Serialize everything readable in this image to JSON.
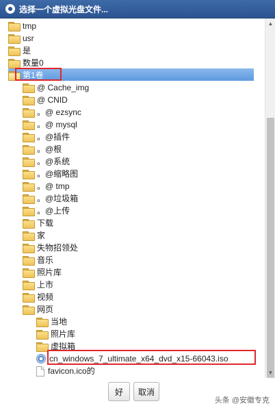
{
  "dialog": {
    "title": "选择一个虚拟光盘文件..."
  },
  "tree": {
    "items": [
      {
        "label": "tmp",
        "icon": "folder-icon",
        "level": 0
      },
      {
        "label": "usr",
        "icon": "folder-icon",
        "level": 0
      },
      {
        "label": "是",
        "icon": "folder-icon",
        "level": 0
      },
      {
        "label": "数量0",
        "icon": "folder-icon",
        "level": 0
      },
      {
        "label": "第1卷",
        "icon": "folder-open-icon",
        "level": 0,
        "selected": true,
        "expanded": true
      },
      {
        "label": "@ Cache_img",
        "icon": "folder-icon",
        "level": 1
      },
      {
        "label": "@ CNID",
        "icon": "folder-icon",
        "level": 1
      },
      {
        "label": "。@ ezsync",
        "icon": "folder-icon",
        "level": 1
      },
      {
        "label": "。@ mysql",
        "icon": "folder-icon",
        "level": 1
      },
      {
        "label": "。@插件",
        "icon": "folder-icon",
        "level": 1
      },
      {
        "label": "。@根",
        "icon": "folder-icon",
        "level": 1
      },
      {
        "label": "。@系统",
        "icon": "folder-icon",
        "level": 1
      },
      {
        "label": "。@缩略图",
        "icon": "folder-icon",
        "level": 1
      },
      {
        "label": "。@ tmp",
        "icon": "folder-icon",
        "level": 1
      },
      {
        "label": "。@垃圾箱",
        "icon": "folder-icon",
        "level": 1
      },
      {
        "label": "。@上传",
        "icon": "folder-icon",
        "level": 1
      },
      {
        "label": "下载",
        "icon": "folder-icon",
        "level": 1
      },
      {
        "label": "家",
        "icon": "folder-icon",
        "level": 1
      },
      {
        "label": "失物招领处",
        "icon": "folder-icon",
        "level": 1
      },
      {
        "label": "音乐",
        "icon": "folder-icon",
        "level": 1
      },
      {
        "label": "照片库",
        "icon": "folder-icon",
        "level": 1
      },
      {
        "label": "上市",
        "icon": "folder-icon",
        "level": 1
      },
      {
        "label": "视频",
        "icon": "folder-icon",
        "level": 1
      },
      {
        "label": "网页",
        "icon": "folder-icon",
        "level": 1,
        "expanded": true
      },
      {
        "label": "当地",
        "icon": "folder-icon",
        "level": 2
      },
      {
        "label": "照片库",
        "icon": "folder-icon",
        "level": 2
      },
      {
        "label": "虚拟箱",
        "icon": "folder-icon",
        "level": 2
      },
      {
        "label": "cn_windows_7_ultimate_x64_dvd_x15-66043.iso",
        "icon": "disc-icon",
        "level": 2
      },
      {
        "label": "favicon.ico的",
        "icon": "file-icon",
        "level": 2
      }
    ]
  },
  "buttons": {
    "ok": "好",
    "cancel": "取消"
  },
  "watermark": "头条 @安徽专克",
  "colors": {
    "titlebar": "#2b5491",
    "selection": "#5f9ae0",
    "highlight_box": "#e0262b"
  }
}
